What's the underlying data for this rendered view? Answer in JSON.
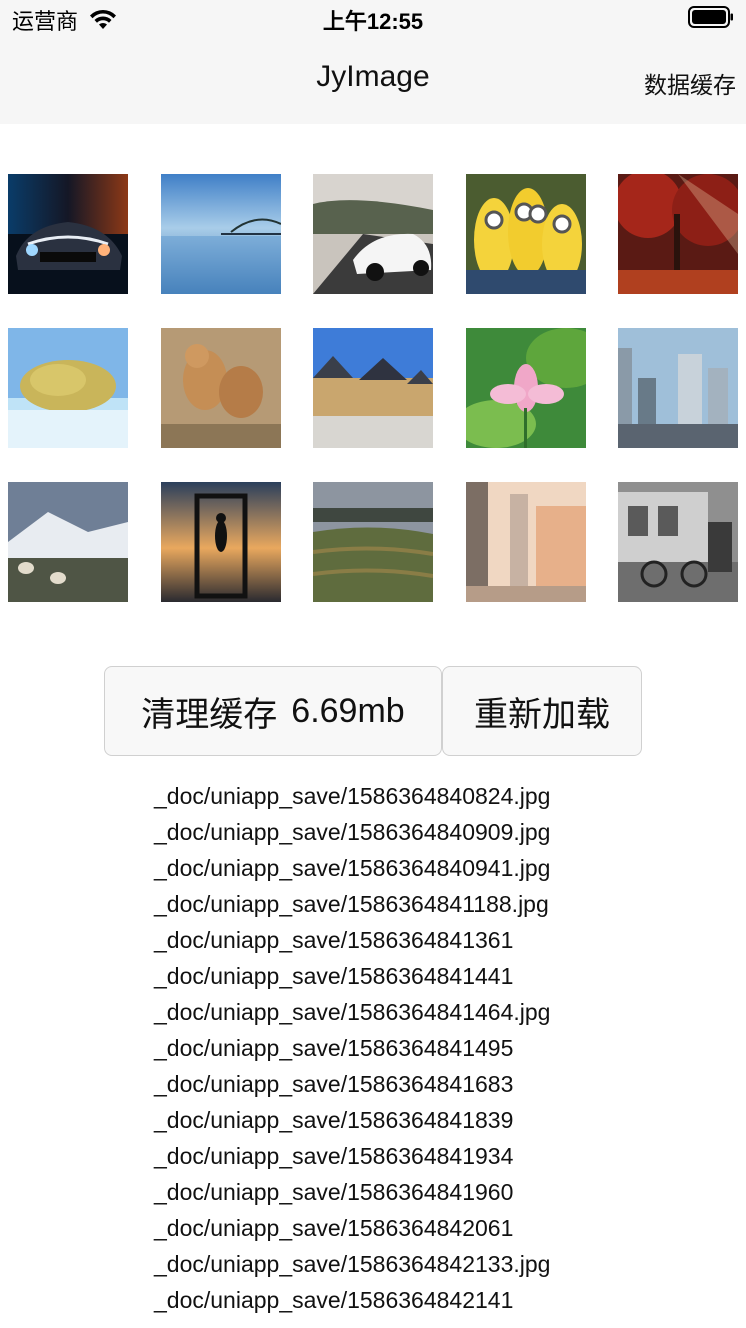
{
  "status_bar": {
    "carrier": "运营商",
    "time": "上午12:55"
  },
  "nav": {
    "title": "JyImage",
    "right_action": "数据缓存"
  },
  "images": [
    {
      "name": "sports-car-fire-ice"
    },
    {
      "name": "bridge-sea-reflection"
    },
    {
      "name": "white-bugatti-road"
    },
    {
      "name": "minions-group"
    },
    {
      "name": "red-autumn-forest"
    },
    {
      "name": "yellow-tree-on-ice"
    },
    {
      "name": "lion-cubs-playing"
    },
    {
      "name": "village-houses"
    },
    {
      "name": "pink-lotus-flower"
    },
    {
      "name": "city-skyscrapers"
    },
    {
      "name": "snowy-mountain-sheep"
    },
    {
      "name": "woman-in-frame-sunset"
    },
    {
      "name": "terraced-fields-bridge"
    },
    {
      "name": "city-street-buildings"
    },
    {
      "name": "bicycle-by-house"
    }
  ],
  "buttons": {
    "clear_label": "清理缓存",
    "cache_size": "6.69mb",
    "reload_label": "重新加载"
  },
  "files": [
    "_doc/uniapp_save/1586364840824.jpg",
    "_doc/uniapp_save/1586364840909.jpg",
    "_doc/uniapp_save/1586364840941.jpg",
    "_doc/uniapp_save/1586364841188.jpg",
    "_doc/uniapp_save/1586364841361",
    "_doc/uniapp_save/1586364841441",
    "_doc/uniapp_save/1586364841464.jpg",
    "_doc/uniapp_save/1586364841495",
    "_doc/uniapp_save/1586364841683",
    "_doc/uniapp_save/1586364841839",
    "_doc/uniapp_save/1586364841934",
    "_doc/uniapp_save/1586364841960",
    "_doc/uniapp_save/1586364842061",
    "_doc/uniapp_save/1586364842133.jpg",
    "_doc/uniapp_save/1586364842141"
  ]
}
